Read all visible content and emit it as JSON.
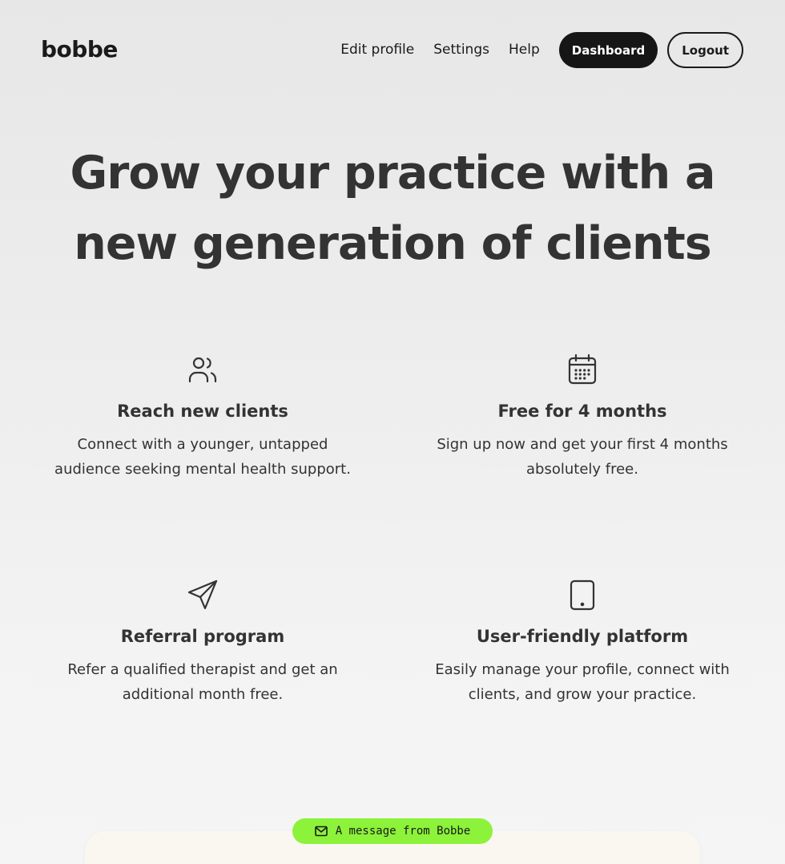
{
  "header": {
    "logo": "bobbe",
    "nav": {
      "edit_profile": "Edit profile",
      "settings": "Settings",
      "help": "Help",
      "dashboard": "Dashboard",
      "logout": "Logout"
    }
  },
  "hero": {
    "title": "Grow your practice with a new generation of clients"
  },
  "features": [
    {
      "icon": "users-icon",
      "title": "Reach new clients",
      "description": "Connect with a younger, untapped audience seeking mental health support."
    },
    {
      "icon": "calendar-icon",
      "title": "Free for 4 months",
      "description": "Sign up now and get your first 4 months absolutely free."
    },
    {
      "icon": "send-icon",
      "title": "Referral program",
      "description": "Refer a qualified therapist and get an additional month free."
    },
    {
      "icon": "tablet-icon",
      "title": "User-friendly platform",
      "description": "Easily manage your profile, connect with clients, and grow your practice."
    }
  ],
  "message": {
    "icon": "mail-icon",
    "label": "A message from Bobbe"
  },
  "colors": {
    "primary_dark": "#161616",
    "accent_green": "#8cf23a",
    "text": "#333333",
    "card_bg": "#faf7f1"
  }
}
